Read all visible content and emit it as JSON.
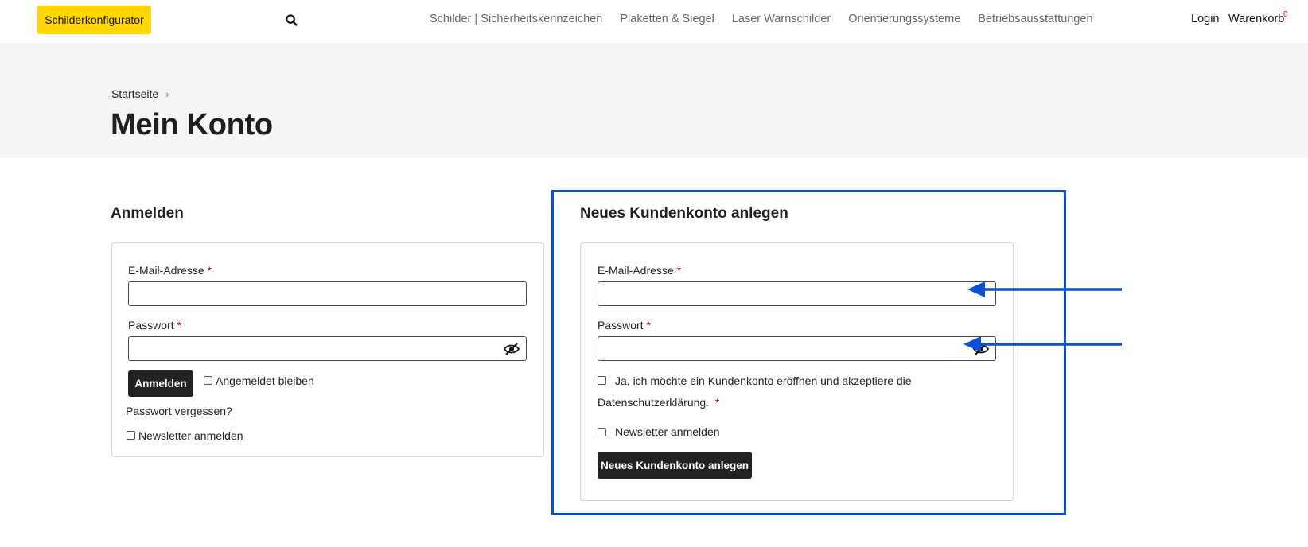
{
  "header": {
    "configurator_label": "Schilderkonfigurator",
    "search_icon": "search-icon",
    "nav": [
      "Schilder | Sicherheitskennzeichen",
      "Plaketten & Siegel",
      "Laser Warnschilder",
      "Orientierungssysteme",
      "Betriebsausstattungen"
    ],
    "login_label": "Login",
    "cart_label": "Warenkorb",
    "cart_count": "0"
  },
  "breadcrumb": {
    "home": "Startseite",
    "separator": "›"
  },
  "page_title": "Mein Konto",
  "login": {
    "title": "Anmelden",
    "email_label": "E-Mail-Adresse",
    "password_label": "Passwort",
    "required_mark": "*",
    "submit_label": "Anmelden",
    "remember_label": "Angemeldet bleiben",
    "forgot_label": "Passwort vergessen?",
    "newsletter_label": "Newsletter anmelden"
  },
  "register": {
    "title": "Neues Kundenkonto anlegen",
    "email_label": "E-Mail-Adresse",
    "password_label": "Passwort",
    "required_mark": "*",
    "consent_line1": "Ja, ich möchte ein Kundenkonto eröffnen und akzeptiere die",
    "consent_line2": "Datenschutzerklärung.",
    "newsletter_label": "Newsletter anmelden",
    "submit_label": "Neues Kundenkonto anlegen"
  },
  "colors": {
    "accent_yellow": "#ffd600",
    "highlight_blue": "#0a4fd6",
    "required_red": "#b10f0f",
    "button_dark": "#222222"
  }
}
